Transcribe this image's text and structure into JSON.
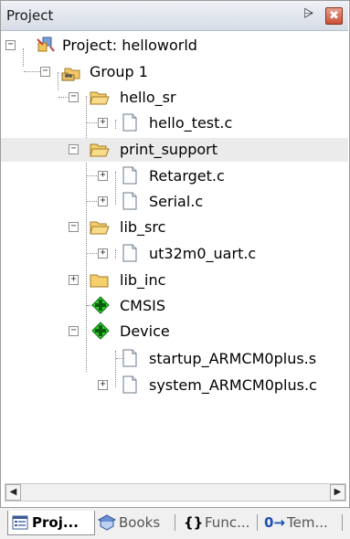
{
  "window": {
    "title": "Project",
    "pin_glyph": "⩥",
    "close_glyph": "✖"
  },
  "tree": [
    {
      "label": "Project: helloworld",
      "icon": "project-icon",
      "state": "minus"
    },
    {
      "label": "Group 1",
      "icon": "group-icon",
      "state": "minus"
    },
    {
      "label": "hello_sr",
      "icon": "folder-open-icon",
      "state": "minus"
    },
    {
      "label": "hello_test.c",
      "icon": "file-icon",
      "state": "plus"
    },
    {
      "label": "print_support",
      "icon": "folder-open-icon",
      "state": "minus",
      "selected": true
    },
    {
      "label": "Retarget.c",
      "icon": "file-icon",
      "state": "plus"
    },
    {
      "label": "Serial.c",
      "icon": "file-icon",
      "state": "plus"
    },
    {
      "label": "lib_src",
      "icon": "folder-open-icon",
      "state": "minus"
    },
    {
      "label": "ut32m0_uart.c",
      "icon": "file-icon",
      "state": "plus"
    },
    {
      "label": "lib_inc",
      "icon": "folder-closed-icon",
      "state": "plus"
    },
    {
      "label": "CMSIS",
      "icon": "component-icon",
      "state": "none"
    },
    {
      "label": "Device",
      "icon": "component-icon",
      "state": "minus"
    },
    {
      "label": "startup_ARMCM0plus.s",
      "icon": "file-icon",
      "state": "none"
    },
    {
      "label": "system_ARMCM0plus.c",
      "icon": "file-icon",
      "state": "plus"
    }
  ],
  "scrollbar": {
    "left_glyph": "◀",
    "right_glyph": "▶"
  },
  "tabs": [
    {
      "label": "Proj...",
      "icon": "project-tab-icon",
      "active": true
    },
    {
      "label": "Books",
      "icon": "books-icon"
    },
    {
      "label": "Func...",
      "icon": "functions-icon",
      "glyph": "{}"
    },
    {
      "label": "Tem...",
      "icon": "templates-icon",
      "glyph": "0→"
    }
  ]
}
